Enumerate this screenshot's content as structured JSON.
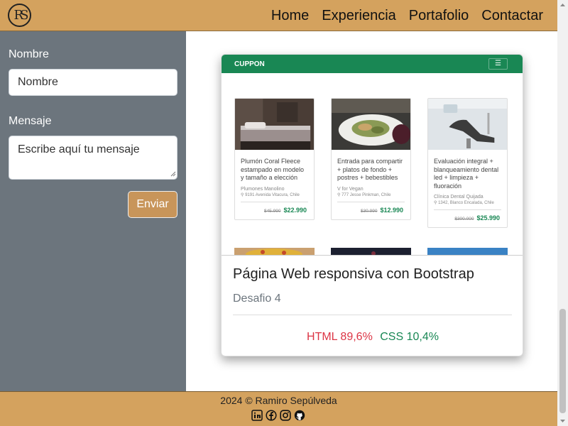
{
  "nav": {
    "logo": "RS",
    "links": [
      "Home",
      "Experiencia",
      "Portafolio",
      "Contactar"
    ]
  },
  "form": {
    "name_label": "Nombre",
    "name_placeholder": "Nombre",
    "message_label": "Mensaje",
    "message_placeholder": "Escribe aquí tu mensaje",
    "submit_label": "Enviar"
  },
  "project": {
    "preview": {
      "brand": "CUPPON",
      "toggler": "☰",
      "cards": [
        {
          "title": "Plumón Coral Fleece estampado en modelo y tamaño a elección",
          "shop": "Plumones Manolino",
          "address": "9191 Avenida Vitacura, Chile",
          "old_price": "$45.990",
          "new_price": "$22.990"
        },
        {
          "title": "Entrada para compartir + platos de fondo + postres + bebestibles",
          "shop": "V for Vegan",
          "address": "777 Jesse Pinkman, Chile",
          "old_price": "$30.990",
          "new_price": "$12.990"
        },
        {
          "title": "Evaluación integral + blanqueamiento dental led + limpieza + fluoración",
          "shop": "Clínica Dental Quijada",
          "address": "1342, Blanco Encalada, Chile",
          "old_price": "$300.000",
          "new_price": "$25.990"
        }
      ]
    },
    "title": "Página Web responsiva con Bootstrap",
    "subtitle": "Desafio 4",
    "languages": {
      "html": "HTML 89,6%",
      "css": "CSS 10,4%"
    }
  },
  "footer": {
    "copyright": "2024 © Ramiro Sepúlveda",
    "social_icons": [
      "linkedin-icon",
      "facebook-icon",
      "instagram-icon",
      "github-icon"
    ]
  },
  "colors": {
    "navbar": "#d4a25e",
    "sidebar": "#6c757d",
    "accent_green": "#198754",
    "html_red": "#dc3545"
  }
}
